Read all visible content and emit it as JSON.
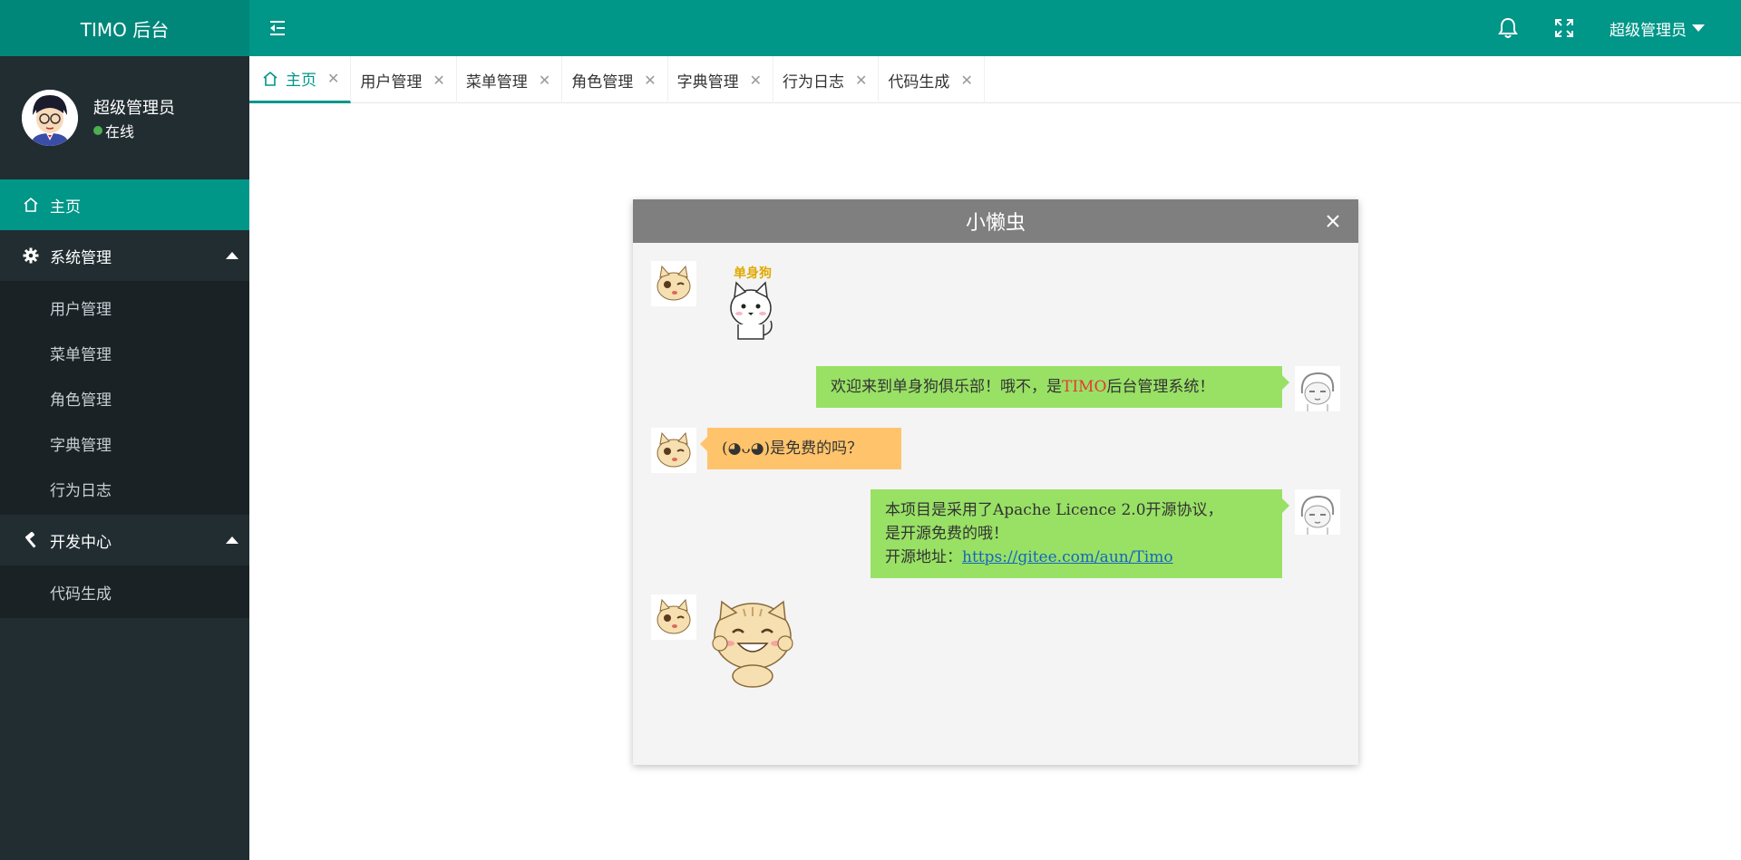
{
  "app": {
    "title": "TIMO 后台"
  },
  "header": {
    "user_name": "超级管理员",
    "icons": [
      "menu-toggle-icon",
      "bell-icon",
      "fullscreen-icon"
    ]
  },
  "sidebar": {
    "user": {
      "name": "超级管理员",
      "status": "在线"
    },
    "home": "主页",
    "groups": [
      {
        "label": "系统管理",
        "icon": "gear-icon",
        "items": [
          "用户管理",
          "菜单管理",
          "角色管理",
          "字典管理",
          "行为日志"
        ]
      },
      {
        "label": "开发中心",
        "icon": "hammer-icon",
        "items": [
          "代码生成"
        ]
      }
    ]
  },
  "tabs": [
    "主页",
    "用户管理",
    "菜单管理",
    "角色管理",
    "字典管理",
    "行为日志",
    "代码生成"
  ],
  "dialog": {
    "title": "小懒虫",
    "sticker_text": "单身狗",
    "messages": {
      "m1_pre": "欢迎来到单身狗俱乐部！哦不，是",
      "m1_red": "TIMO",
      "m1_post": "后台管理系统！",
      "m2": "(◕ᴗ◕)是免费的吗？",
      "m3_line1": "本项目是采用了Apache Licence 2.0开源协议，",
      "m3_line2": "是开源免费的哦！",
      "m3_prefix": "开源地址：",
      "m3_link": "https://gitee.com/aun/Timo"
    }
  },
  "colors": {
    "primary": "#009688",
    "sidebar": "#222d32",
    "green_bubble": "#98e165",
    "orange_bubble": "#ffc46b"
  }
}
